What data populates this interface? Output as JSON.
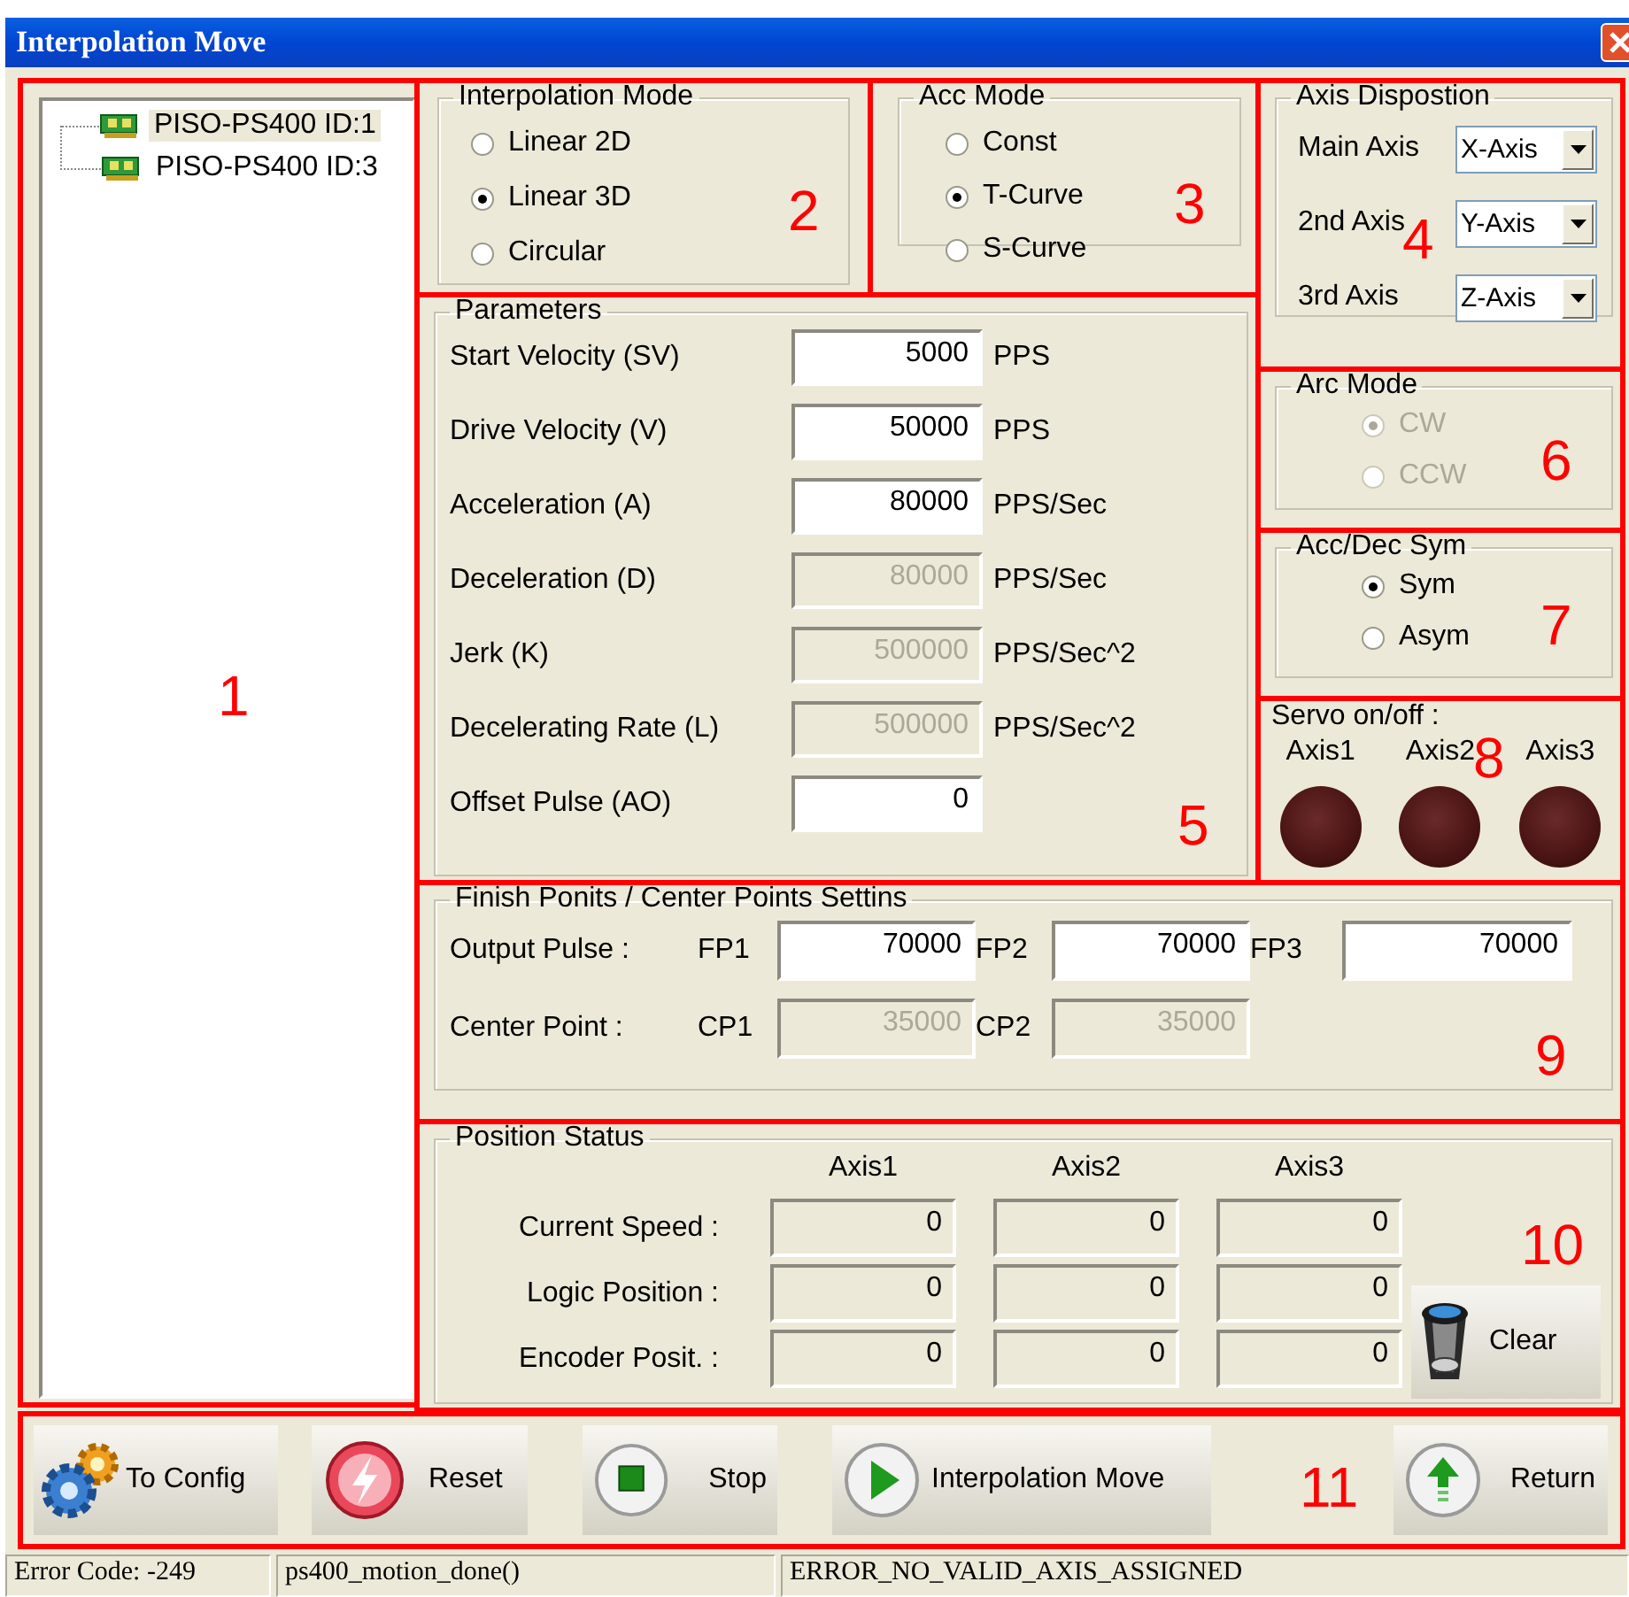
{
  "window": {
    "title": "Interpolation Move"
  },
  "device_tree": {
    "marker": "1",
    "items": [
      {
        "label": "PISO-PS400 ID:1",
        "selected": true
      },
      {
        "label": "PISO-PS400 ID:3",
        "selected": false
      }
    ]
  },
  "interpolation_mode": {
    "title": "Interpolation Mode",
    "marker": "2",
    "options": [
      {
        "label": "Linear 2D",
        "selected": false
      },
      {
        "label": "Linear 3D",
        "selected": true
      },
      {
        "label": "Circular",
        "selected": false
      }
    ]
  },
  "acc_mode": {
    "title": "Acc Mode",
    "marker": "3",
    "options": [
      {
        "label": "Const",
        "selected": false
      },
      {
        "label": "T-Curve",
        "selected": true
      },
      {
        "label": "S-Curve",
        "selected": false
      }
    ]
  },
  "axis_disposition": {
    "title": "Axis Dispostion",
    "marker": "4",
    "rows": [
      {
        "label": "Main Axis",
        "value": "X-Axis"
      },
      {
        "label": "2nd Axis",
        "value": "Y-Axis"
      },
      {
        "label": "3rd Axis",
        "value": "Z-Axis"
      }
    ]
  },
  "parameters": {
    "title": "Parameters",
    "marker": "5",
    "rows": [
      {
        "label": "Start Velocity (SV)",
        "value": "5000",
        "unit": "PPS",
        "disabled": false
      },
      {
        "label": "Drive Velocity (V)",
        "value": "50000",
        "unit": "PPS",
        "disabled": false
      },
      {
        "label": "Acceleration (A)",
        "value": "80000",
        "unit": "PPS/Sec",
        "disabled": false
      },
      {
        "label": "Deceleration (D)",
        "value": "80000",
        "unit": "PPS/Sec",
        "disabled": true
      },
      {
        "label": "Jerk (K)",
        "value": "500000",
        "unit": "PPS/Sec^2",
        "disabled": true
      },
      {
        "label": "Decelerating Rate (L)",
        "value": "500000",
        "unit": "PPS/Sec^2",
        "disabled": true
      },
      {
        "label": "Offset Pulse (AO)",
        "value": "0",
        "disabled": false
      }
    ]
  },
  "arc_mode": {
    "title": "Arc Mode",
    "marker": "6",
    "disabled": true,
    "options": [
      {
        "label": "CW",
        "selected": true
      },
      {
        "label": "CCW",
        "selected": false
      }
    ]
  },
  "acc_dec_sym": {
    "title": "Acc/Dec Sym",
    "marker": "7",
    "options": [
      {
        "label": "Sym",
        "selected": true
      },
      {
        "label": "Asym",
        "selected": false
      }
    ]
  },
  "servo": {
    "title": "Servo on/off :",
    "marker": "8",
    "axes": [
      {
        "label": "Axis1",
        "on": false
      },
      {
        "label": "Axis2",
        "on": false
      },
      {
        "label": "Axis3",
        "on": false
      }
    ]
  },
  "finish_points": {
    "title": "Finish Ponits / Center Points Settins",
    "marker": "9",
    "rows": [
      {
        "label": "Output Pulse :",
        "fields": [
          {
            "label": "FP1",
            "value": "70000",
            "disabled": false
          },
          {
            "label": "FP2",
            "value": "70000",
            "disabled": false
          },
          {
            "label": "FP3",
            "value": "70000",
            "disabled": false
          }
        ]
      },
      {
        "label": "Center Point :",
        "fields": [
          {
            "label": "CP1",
            "value": "35000",
            "disabled": true
          },
          {
            "label": "CP2",
            "value": "35000",
            "disabled": true
          }
        ]
      }
    ]
  },
  "position_status": {
    "title": "Position Status",
    "marker": "10",
    "columns": [
      "Axis1",
      "Axis2",
      "Axis3"
    ],
    "rows": [
      {
        "label": "Current Speed :",
        "values": [
          "0",
          "0",
          "0"
        ]
      },
      {
        "label": "Logic Position :",
        "values": [
          "0",
          "0",
          "0"
        ]
      },
      {
        "label": "Encoder Posit. :",
        "values": [
          "0",
          "0",
          "0"
        ]
      }
    ],
    "clear_button": "Clear"
  },
  "toolbar": {
    "marker": "11",
    "buttons": [
      {
        "label": "To Config",
        "kind": "gear"
      },
      {
        "label": "Reset",
        "kind": "reset"
      },
      {
        "label": "Stop",
        "kind": "stop"
      },
      {
        "label": "Interpolation Move",
        "kind": "play"
      },
      {
        "label": "Return",
        "kind": "up"
      }
    ]
  },
  "status_bar": [
    "Error Code: -249",
    "ps400_motion_done()",
    "ERROR_NO_VALID_AXIS_ASSIGNED"
  ]
}
